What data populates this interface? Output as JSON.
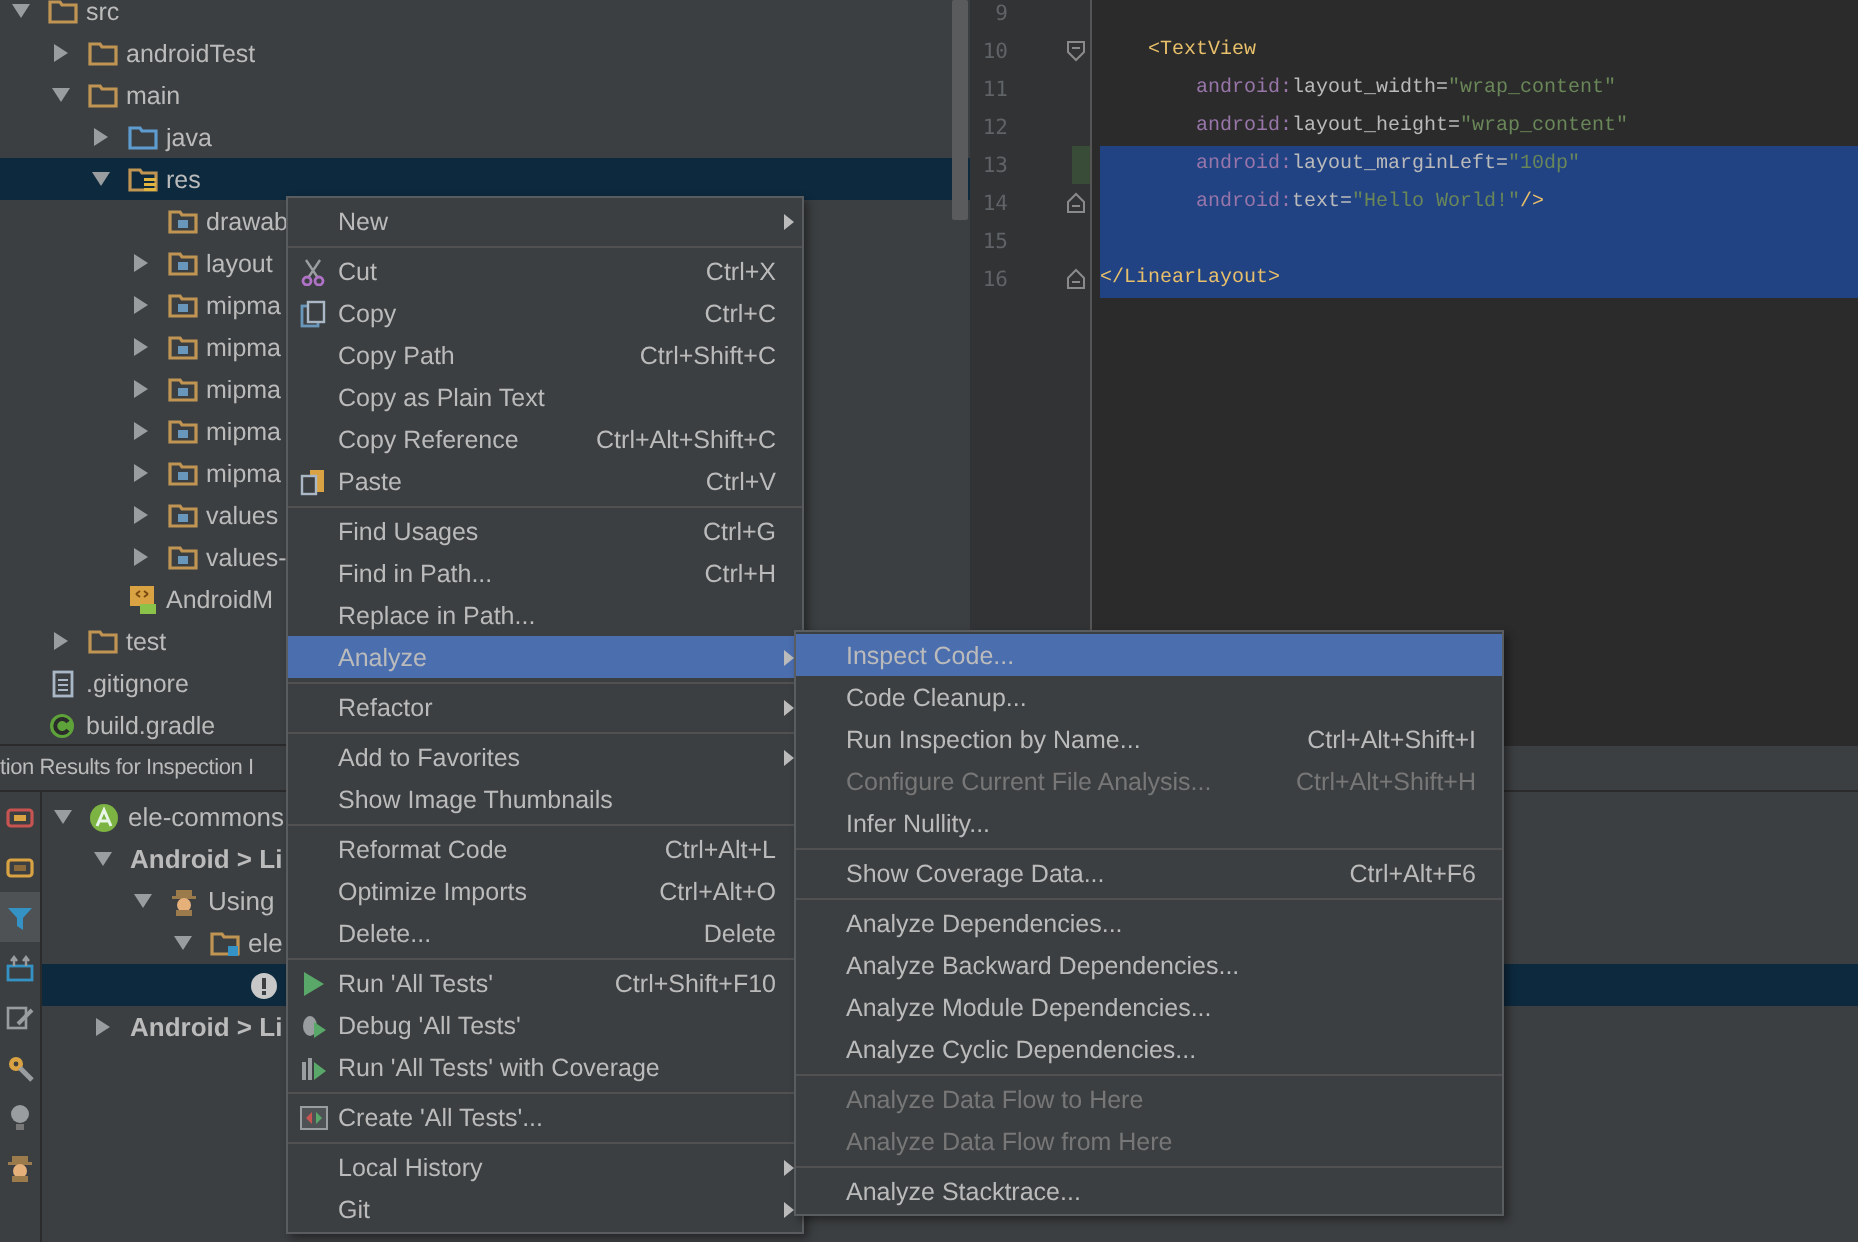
{
  "project_tree": [
    {
      "label": "src",
      "kind": "folder",
      "expanded": true,
      "selected": false,
      "children": [
        {
          "label": "androidTest",
          "kind": "folder",
          "expanded": false,
          "selected": false
        },
        {
          "label": "main",
          "kind": "folder",
          "expanded": true,
          "selected": false,
          "children": [
            {
              "label": "java",
              "kind": "source-folder",
              "expanded": false,
              "selected": false
            },
            {
              "label": "res",
              "kind": "res-root",
              "expanded": true,
              "selected": true,
              "children": [
                {
                  "label": "drawab",
                  "kind": "res-folder",
                  "selected": false
                },
                {
                  "label": "layout",
                  "kind": "res-folder",
                  "expanded": false,
                  "selected": false
                },
                {
                  "label": "mipma",
                  "kind": "res-folder",
                  "expanded": false,
                  "selected": false
                },
                {
                  "label": "mipma",
                  "kind": "res-folder",
                  "expanded": false,
                  "selected": false
                },
                {
                  "label": "mipma",
                  "kind": "res-folder",
                  "expanded": false,
                  "selected": false
                },
                {
                  "label": "mipma",
                  "kind": "res-folder",
                  "expanded": false,
                  "selected": false
                },
                {
                  "label": "mipma",
                  "kind": "res-folder",
                  "expanded": false,
                  "selected": false
                },
                {
                  "label": "values",
                  "kind": "res-folder",
                  "expanded": false,
                  "selected": false
                },
                {
                  "label": "values-",
                  "kind": "res-folder",
                  "expanded": false,
                  "selected": false
                }
              ]
            },
            {
              "label": "AndroidM",
              "kind": "manifest",
              "selected": false
            }
          ]
        },
        {
          "label": "test",
          "kind": "folder",
          "expanded": false,
          "selected": false
        }
      ]
    },
    {
      "label": ".gitignore",
      "kind": "text-file",
      "selected": false
    },
    {
      "label": "build.gradle",
      "kind": "gradle-file",
      "selected": false
    }
  ],
  "editor": {
    "lines": [
      {
        "number": "9",
        "fold": false,
        "selected": false,
        "changed": false
      },
      {
        "number": "10",
        "kind": "open-tag",
        "fold": true,
        "selected": false,
        "changed": false,
        "tokens": [
          {
            "kind": "tag",
            "text": "<TextView"
          }
        ]
      },
      {
        "number": "11",
        "kind": "attribute",
        "fold": false,
        "selected": false,
        "changed": false,
        "tokens": [
          {
            "kind": "ns",
            "text": "android:"
          },
          {
            "kind": "attr",
            "text": "layout_width="
          },
          {
            "kind": "value",
            "text": "\"wrap_content\""
          }
        ]
      },
      {
        "number": "12",
        "kind": "attribute",
        "fold": false,
        "selected": false,
        "changed": false,
        "tokens": [
          {
            "kind": "ns",
            "text": "android:"
          },
          {
            "kind": "attr",
            "text": "layout_height="
          },
          {
            "kind": "value",
            "text": "\"wrap_content\""
          }
        ]
      },
      {
        "number": "13",
        "kind": "attribute",
        "fold": false,
        "selected": true,
        "changed": true,
        "tokens": [
          {
            "kind": "ns",
            "text": "android:"
          },
          {
            "kind": "attr",
            "text": "layout_marginLeft="
          },
          {
            "kind": "value",
            "text": "\"10dp\""
          }
        ]
      },
      {
        "number": "14",
        "kind": "attribute",
        "fold": true,
        "selected": true,
        "changed": false,
        "tokens": [
          {
            "kind": "ns",
            "text": "android:"
          },
          {
            "kind": "attr",
            "text": "text="
          },
          {
            "kind": "value",
            "text": "\"Hello World!\""
          },
          {
            "kind": "tag",
            "text": "/>"
          }
        ]
      },
      {
        "number": "15",
        "fold": false,
        "selected": true,
        "changed": false
      },
      {
        "number": "16",
        "kind": "close-tag",
        "fold": true,
        "selected": true,
        "changed": false,
        "tokens": [
          {
            "kind": "tag",
            "text": "</LinearLayout>"
          }
        ]
      }
    ]
  },
  "inspection_panel": {
    "title": "tion Results for Inspection I",
    "tools": [
      {
        "kind": "group",
        "selected": false
      },
      {
        "kind": "module",
        "selected": false
      },
      {
        "kind": "filter",
        "selected": true
      },
      {
        "kind": "export",
        "selected": false
      },
      {
        "kind": "edit",
        "selected": false
      },
      {
        "kind": "settings",
        "selected": false
      },
      {
        "kind": "bulb",
        "selected": false
      },
      {
        "kind": "spy",
        "selected": false
      }
    ],
    "tree": [
      {
        "label": "ele-commons",
        "kind": "module",
        "expanded": true,
        "selected": false,
        "children": [
          {
            "label": "Android > Li",
            "kind": "category",
            "expanded": true,
            "selected": false,
            "children": [
              {
                "label": "Using",
                "kind": "inspection",
                "expanded": true,
                "selected": false,
                "children": [
                  {
                    "label": "ele",
                    "kind": "folder",
                    "expanded": true,
                    "selected": false,
                    "children": [
                      {
                        "kind": "problem",
                        "selected": true
                      }
                    ]
                  }
                ]
              }
            ]
          },
          {
            "label": "Android > Li",
            "kind": "category",
            "expanded": false,
            "selected": false
          }
        ]
      }
    ]
  },
  "context_menu": {
    "groups": [
      {
        "items": [
          {
            "label": "New",
            "has_submenu": true,
            "selected": false
          }
        ]
      },
      {
        "items": [
          {
            "label": "Cut",
            "kind": "cut",
            "shortcut": "Ctrl+X",
            "has_submenu": false,
            "selected": false
          },
          {
            "label": "Copy",
            "kind": "copy",
            "shortcut": "Ctrl+C",
            "has_submenu": false,
            "selected": false
          },
          {
            "label": "Copy Path",
            "shortcut": "Ctrl+Shift+C",
            "has_submenu": false,
            "selected": false
          },
          {
            "label": "Copy as Plain Text",
            "has_submenu": false,
            "selected": false
          },
          {
            "label": "Copy Reference",
            "shortcut": "Ctrl+Alt+Shift+C",
            "has_submenu": false,
            "selected": false
          },
          {
            "label": "Paste",
            "kind": "paste",
            "shortcut": "Ctrl+V",
            "has_submenu": false,
            "selected": false
          }
        ]
      },
      {
        "items": [
          {
            "label": "Find Usages",
            "shortcut": "Ctrl+G",
            "has_submenu": false,
            "selected": false
          },
          {
            "label": "Find in Path...",
            "shortcut": "Ctrl+H",
            "has_submenu": false,
            "selected": false
          },
          {
            "label": "Replace in Path...",
            "has_submenu": false,
            "selected": false
          },
          {
            "label": "Analyze",
            "has_submenu": true,
            "selected": true
          }
        ]
      },
      {
        "items": [
          {
            "label": "Refactor",
            "has_submenu": true,
            "selected": false
          }
        ]
      },
      {
        "items": [
          {
            "label": "Add to Favorites",
            "has_submenu": true,
            "selected": false
          },
          {
            "label": "Show Image Thumbnails",
            "has_submenu": false,
            "selected": false
          }
        ]
      },
      {
        "items": [
          {
            "label": "Reformat Code",
            "shortcut": "Ctrl+Alt+L",
            "has_submenu": false,
            "selected": false
          },
          {
            "label": "Optimize Imports",
            "shortcut": "Ctrl+Alt+O",
            "has_submenu": false,
            "selected": false
          },
          {
            "label": "Delete...",
            "shortcut": "Delete",
            "has_submenu": false,
            "selected": false
          }
        ]
      },
      {
        "items": [
          {
            "label": "Run 'All Tests'",
            "kind": "run",
            "shortcut": "Ctrl+Shift+F10",
            "has_submenu": false,
            "selected": false
          },
          {
            "label": "Debug 'All Tests'",
            "kind": "debug",
            "has_submenu": false,
            "selected": false
          },
          {
            "label": "Run 'All Tests' with Coverage",
            "kind": "coverage",
            "has_submenu": false,
            "selected": false
          }
        ]
      },
      {
        "items": [
          {
            "label": "Create 'All Tests'...",
            "kind": "create",
            "has_submenu": false,
            "selected": false
          }
        ]
      },
      {
        "items": [
          {
            "label": "Local History",
            "has_submenu": true,
            "selected": false
          },
          {
            "label": "Git",
            "has_submenu": true,
            "selected": false
          }
        ]
      }
    ]
  },
  "analyze_submenu": {
    "groups": [
      {
        "items": [
          {
            "label": "Inspect Code...",
            "selected": true,
            "disabled": false
          },
          {
            "label": "Code Cleanup...",
            "selected": false,
            "disabled": false
          },
          {
            "label": "Run Inspection by Name...",
            "shortcut": "Ctrl+Alt+Shift+I",
            "selected": false,
            "disabled": false
          },
          {
            "label": "Configure Current File Analysis...",
            "shortcut": "Ctrl+Alt+Shift+H",
            "selected": false,
            "disabled": true
          },
          {
            "label": "Infer Nullity...",
            "selected": false,
            "disabled": false
          }
        ]
      },
      {
        "items": [
          {
            "label": "Show Coverage Data...",
            "shortcut": "Ctrl+Alt+F6",
            "selected": false,
            "disabled": false
          }
        ]
      },
      {
        "items": [
          {
            "label": "Analyze Dependencies...",
            "selected": false,
            "disabled": false
          },
          {
            "label": "Analyze Backward Dependencies...",
            "selected": false,
            "disabled": false
          },
          {
            "label": "Analyze Module Dependencies...",
            "selected": false,
            "disabled": false
          },
          {
            "label": "Analyze Cyclic Dependencies...",
            "selected": false,
            "disabled": false
          }
        ]
      },
      {
        "items": [
          {
            "label": "Analyze Data Flow to Here",
            "selected": false,
            "disabled": true
          },
          {
            "label": "Analyze Data Flow from Here",
            "selected": false,
            "disabled": true
          }
        ]
      },
      {
        "items": [
          {
            "label": "Analyze Stacktrace...",
            "selected": false,
            "disabled": false
          }
        ]
      }
    ]
  }
}
